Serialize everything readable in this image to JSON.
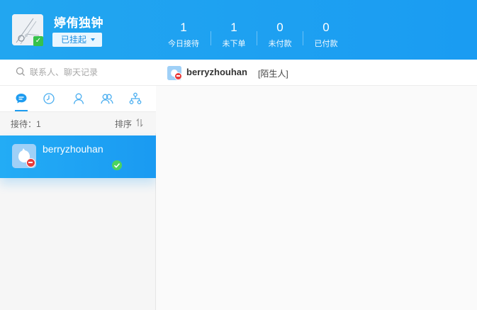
{
  "agent": {
    "name": "婷侑独钟",
    "status": "已挂起",
    "online_badge": "check-icon"
  },
  "stats": [
    {
      "value": "1",
      "label": "今日接待"
    },
    {
      "value": "1",
      "label": "未下单"
    },
    {
      "value": "0",
      "label": "未付款"
    },
    {
      "value": "0",
      "label": "已付款"
    }
  ],
  "search": {
    "placeholder": "联系人、聊天记录"
  },
  "tabs": [
    {
      "icon": "chat-bubble-icon",
      "active": true
    },
    {
      "icon": "clock-icon",
      "active": false
    },
    {
      "icon": "person-icon",
      "active": false
    },
    {
      "icon": "group-icon",
      "active": false
    },
    {
      "icon": "org-tree-icon",
      "active": false
    }
  ],
  "list": {
    "count_label": "接待：1",
    "sort_label": "排序"
  },
  "sessions": [
    {
      "name": "berryzhouhan",
      "status": "check-icon"
    }
  ],
  "chat": {
    "contact_name": "berryzhouhan",
    "contact_tag": "[陌生人]"
  },
  "colors": {
    "accent": "#1a9cf2",
    "online": "#36c24b",
    "alert": "#e83b3b"
  }
}
